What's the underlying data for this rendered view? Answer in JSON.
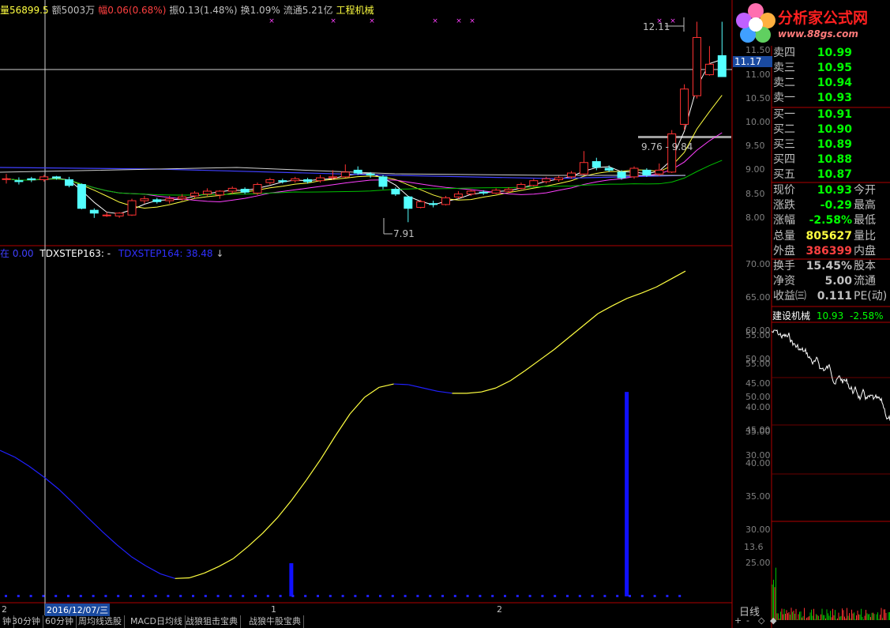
{
  "top_info": [
    {
      "text": "量56899.5",
      "color": "#ffff40"
    },
    {
      "text": "额5003万",
      "color": "#c0c0c0"
    },
    {
      "text": "幅",
      "color": "#ff4040"
    },
    {
      "text": "0.06(0.68%)",
      "color": "#ff4040"
    },
    {
      "text": "振0.13(1.48%)",
      "color": "#c0c0c0"
    },
    {
      "text": "换1.09%",
      "color": "#c0c0c0"
    },
    {
      "text": "流通5.21亿",
      "color": "#c0c0c0"
    },
    {
      "text": "工程机械",
      "color": "#ffff40"
    }
  ],
  "indicator_labels": {
    "prefix": "在",
    "prefix_val": "0.00",
    "line1": "TDXSTEP163: -",
    "line2": "TDXSTEP164: 38.48",
    "arrow": "↓"
  },
  "price_axis": {
    "ticks": [
      "11.50",
      "11.00",
      "10.50",
      "10.00",
      "9.50",
      "9.00",
      "8.50",
      "8.00"
    ],
    "current": "11.17"
  },
  "indicator_axis": {
    "ticks": [
      "70.00",
      "65.00",
      "60.00",
      "55.00",
      "50.00",
      "45.00",
      "40.00",
      "35.00",
      "30.00",
      "25.00"
    ]
  },
  "annotations": {
    "high": "12.11",
    "low": "7.91",
    "range": "9.76 - 9.84"
  },
  "x_axis": {
    "labels": [
      "2",
      "2016/12/07/三",
      "1",
      "2"
    ],
    "period": "日线"
  },
  "bottom_tabs": [
    "钟",
    "30分钟",
    "60分钟",
    "周均线选股",
    "MACD日均线",
    "战狼狙击宝典",
    "战狼牛股宝典"
  ],
  "scroll_icons": [
    "+",
    "-",
    "◇",
    "◆"
  ],
  "logo": {
    "title": "分析家公式网",
    "url": "www.88gs.com"
  },
  "order_book": {
    "asks": [
      {
        "label": "卖四",
        "price": "10.99"
      },
      {
        "label": "卖三",
        "price": "10.95"
      },
      {
        "label": "卖二",
        "price": "10.94"
      },
      {
        "label": "卖一",
        "price": "10.93"
      }
    ],
    "bids": [
      {
        "label": "买一",
        "price": "10.91"
      },
      {
        "label": "买二",
        "price": "10.90"
      },
      {
        "label": "买三",
        "price": "10.89"
      },
      {
        "label": "买四",
        "price": "10.88"
      },
      {
        "label": "买五",
        "price": "10.87"
      }
    ]
  },
  "quote": [
    {
      "l1": "现价",
      "v": "10.93",
      "l2": "今开",
      "color": "#00ff00"
    },
    {
      "l1": "涨跌",
      "v": "-0.29",
      "l2": "最高",
      "color": "#00ff00"
    },
    {
      "l1": "涨幅",
      "v": "-2.58%",
      "l2": "最低",
      "color": "#00ff00"
    },
    {
      "l1": "总量",
      "v": "805627",
      "l2": "量比",
      "color": "#ffff40"
    },
    {
      "l1": "外盘",
      "v": "386399",
      "l2": "内盘",
      "color": "#ff4040"
    },
    {
      "l1": "换手",
      "v": "15.45%",
      "l2": "股本",
      "color": "#c0c0c0"
    },
    {
      "l1": "净资",
      "v": "5.00",
      "l2": "流通",
      "color": "#c0c0c0"
    },
    {
      "l1": "收益㈢",
      "v": "0.111",
      "l2": "PE(动)",
      "color": "#c0c0c0"
    }
  ],
  "mini_chart": {
    "name": "建设机械",
    "price": "10.93",
    "change": "-2.58%",
    "ticks": [
      "55.00",
      "50.00",
      "45.00",
      "40.00",
      "35.00",
      "30.00"
    ],
    "vol_tick": "13.6"
  },
  "colors": {
    "up": "#ff3232",
    "down": "#54ffff",
    "ma_white": "#ffffff",
    "ma_yellow": "#ffff40",
    "ma_magenta": "#ff40ff",
    "ma_green": "#00c000",
    "ma_blue": "#4040ff",
    "indicator_blue": "#1010ff"
  },
  "chart_data": {
    "type": "candlestick",
    "y_range": [
      7.6,
      12.4
    ],
    "candles": [
      {
        "o": 8.82,
        "c": 8.82,
        "h": 8.92,
        "l": 8.72
      },
      {
        "o": 8.78,
        "c": 8.76,
        "h": 8.85,
        "l": 8.7
      },
      {
        "o": 8.82,
        "c": 8.8,
        "h": 8.86,
        "l": 8.75
      },
      {
        "o": 8.8,
        "c": 8.86,
        "h": 8.9,
        "l": 8.76
      },
      {
        "o": 8.86,
        "c": 8.84,
        "h": 8.88,
        "l": 8.8
      },
      {
        "o": 8.8,
        "c": 8.68,
        "h": 8.86,
        "l": 8.64
      },
      {
        "o": 8.7,
        "c": 8.2,
        "h": 8.72,
        "l": 8.18
      },
      {
        "o": 8.16,
        "c": 8.1,
        "h": 8.2,
        "l": 8.0
      },
      {
        "o": 8.06,
        "c": 8.06,
        "h": 8.12,
        "l": 8.02
      },
      {
        "o": 8.04,
        "c": 8.1,
        "h": 8.12,
        "l": 8.0
      },
      {
        "o": 8.06,
        "c": 8.36,
        "h": 8.4,
        "l": 8.04
      },
      {
        "o": 8.36,
        "c": 8.4,
        "h": 8.46,
        "l": 8.3
      },
      {
        "o": 8.38,
        "c": 8.34,
        "h": 8.42,
        "l": 8.3
      },
      {
        "o": 8.36,
        "c": 8.4,
        "h": 8.46,
        "l": 8.3
      },
      {
        "o": 8.4,
        "c": 8.44,
        "h": 8.5,
        "l": 8.36
      },
      {
        "o": 8.46,
        "c": 8.52,
        "h": 8.56,
        "l": 8.42
      },
      {
        "o": 8.5,
        "c": 8.56,
        "h": 8.62,
        "l": 8.46
      },
      {
        "o": 8.48,
        "c": 8.56,
        "h": 8.58,
        "l": 8.4
      },
      {
        "o": 8.56,
        "c": 8.62,
        "h": 8.66,
        "l": 8.5
      },
      {
        "o": 8.6,
        "c": 8.54,
        "h": 8.64,
        "l": 8.5
      },
      {
        "o": 8.52,
        "c": 8.7,
        "h": 8.74,
        "l": 8.48
      },
      {
        "o": 8.74,
        "c": 8.8,
        "h": 8.84,
        "l": 8.7
      },
      {
        "o": 8.78,
        "c": 8.76,
        "h": 8.82,
        "l": 8.72
      },
      {
        "o": 8.78,
        "c": 8.82,
        "h": 8.86,
        "l": 8.74
      },
      {
        "o": 8.8,
        "c": 8.76,
        "h": 8.84,
        "l": 8.72
      },
      {
        "o": 8.78,
        "c": 8.84,
        "h": 8.9,
        "l": 8.74
      },
      {
        "o": 8.84,
        "c": 8.86,
        "h": 9.0,
        "l": 8.8
      },
      {
        "o": 8.86,
        "c": 8.96,
        "h": 9.12,
        "l": 8.84
      },
      {
        "o": 9.0,
        "c": 8.94,
        "h": 9.08,
        "l": 8.9
      },
      {
        "o": 8.92,
        "c": 8.9,
        "h": 8.96,
        "l": 8.84
      },
      {
        "o": 8.86,
        "c": 8.66,
        "h": 8.9,
        "l": 8.6
      },
      {
        "o": 8.6,
        "c": 8.5,
        "h": 8.64,
        "l": 8.46
      },
      {
        "o": 8.44,
        "c": 8.2,
        "h": 8.46,
        "l": 7.91
      },
      {
        "o": 8.22,
        "c": 8.34,
        "h": 8.38,
        "l": 8.2
      },
      {
        "o": 8.3,
        "c": 8.28,
        "h": 8.36,
        "l": 8.22
      },
      {
        "o": 8.28,
        "c": 8.42,
        "h": 8.46,
        "l": 8.26
      },
      {
        "o": 8.44,
        "c": 8.5,
        "h": 8.56,
        "l": 8.4
      },
      {
        "o": 8.5,
        "c": 8.56,
        "h": 8.6,
        "l": 8.46
      },
      {
        "o": 8.54,
        "c": 8.52,
        "h": 8.58,
        "l": 8.48
      },
      {
        "o": 8.52,
        "c": 8.58,
        "h": 8.62,
        "l": 8.5
      },
      {
        "o": 8.56,
        "c": 8.6,
        "h": 8.64,
        "l": 8.52
      },
      {
        "o": 8.62,
        "c": 8.7,
        "h": 8.74,
        "l": 8.6
      },
      {
        "o": 8.68,
        "c": 8.78,
        "h": 8.82,
        "l": 8.66
      },
      {
        "o": 8.76,
        "c": 8.82,
        "h": 8.86,
        "l": 8.72
      },
      {
        "o": 8.8,
        "c": 8.84,
        "h": 8.88,
        "l": 8.76
      },
      {
        "o": 8.86,
        "c": 8.94,
        "h": 8.98,
        "l": 8.82
      },
      {
        "o": 8.92,
        "c": 9.16,
        "h": 9.4,
        "l": 8.9
      },
      {
        "o": 9.18,
        "c": 9.06,
        "h": 9.26,
        "l": 9.0
      },
      {
        "o": 9.04,
        "c": 9.0,
        "h": 9.1,
        "l": 8.96
      },
      {
        "o": 8.96,
        "c": 8.84,
        "h": 9.0,
        "l": 8.8
      },
      {
        "o": 8.86,
        "c": 9.04,
        "h": 9.08,
        "l": 8.82
      },
      {
        "o": 9.0,
        "c": 8.9,
        "h": 9.04,
        "l": 8.86
      },
      {
        "o": 8.92,
        "c": 9.0,
        "h": 9.14,
        "l": 8.88
      },
      {
        "o": 8.96,
        "c": 9.76,
        "h": 9.84,
        "l": 8.94
      },
      {
        "o": 9.96,
        "c": 10.7,
        "h": 10.8,
        "l": 9.84
      },
      {
        "o": 10.56,
        "c": 11.78,
        "h": 12.11,
        "l": 10.5
      },
      {
        "o": 11.0,
        "c": 11.22,
        "h": 11.6,
        "l": 10.98
      },
      {
        "o": 11.4,
        "c": 10.96,
        "h": 12.11,
        "l": 10.96
      }
    ],
    "indicator_curve": {
      "name": "TDXSTEP164",
      "y_range": [
        20,
        72
      ],
      "values": [
        42.0,
        41.0,
        39.6,
        38.0,
        36.2,
        34.1,
        31.9,
        29.8,
        27.8,
        26.0,
        24.6,
        23.4,
        22.7,
        22.8,
        23.5,
        24.5,
        25.7,
        27.5,
        29.5,
        31.8,
        34.5,
        37.5,
        40.7,
        44.2,
        47.5,
        50.0,
        51.5,
        52.0,
        51.9,
        51.4,
        50.9,
        50.6,
        50.6,
        50.8,
        51.4,
        52.5,
        54.0,
        55.6,
        57.2,
        59.0,
        60.8,
        62.6,
        63.8,
        64.9,
        65.7,
        66.6,
        67.8,
        69.0
      ],
      "signals": [
        {
          "at": 20,
          "from": 25.0
        },
        {
          "at": 43,
          "from": 50.8
        }
      ]
    }
  }
}
